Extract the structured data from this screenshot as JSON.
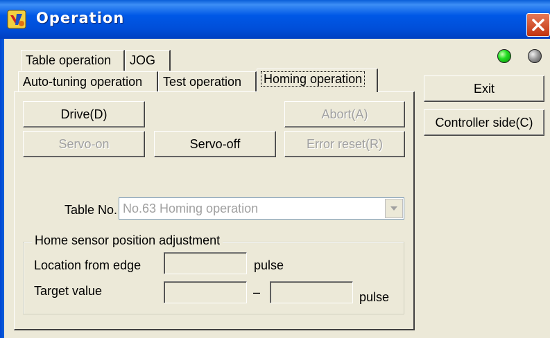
{
  "window": {
    "title": "Operation"
  },
  "tabs": {
    "row1": [
      "Table operation",
      "JOG"
    ],
    "row2": [
      "Auto-tuning operation",
      "Test operation",
      "Homing operation"
    ],
    "active": "Homing operation"
  },
  "indicators": {
    "led1_color": "#22dd22",
    "led2_color": "#9a9a9a"
  },
  "buttons": {
    "drive": "Drive(D)",
    "abort": "Abort(A)",
    "servo_on": "Servo-on",
    "servo_off": "Servo-off",
    "error_reset": "Error reset(R)",
    "exit": "Exit",
    "controller_side": "Controller side(C)"
  },
  "table": {
    "label": "Table No.",
    "selected": "No.63 Homing operation"
  },
  "home_sensor": {
    "title": "Home sensor position adjustment",
    "location_label": "Location from edge",
    "location_unit": "pulse",
    "location_value": "",
    "target_label": "Target value",
    "target_separator": "–",
    "target_unit": "pulse",
    "target_min": "",
    "target_max": ""
  },
  "icons": {
    "app": "app-icon",
    "close": "close-icon",
    "dropdown": "chevron-down-icon"
  }
}
